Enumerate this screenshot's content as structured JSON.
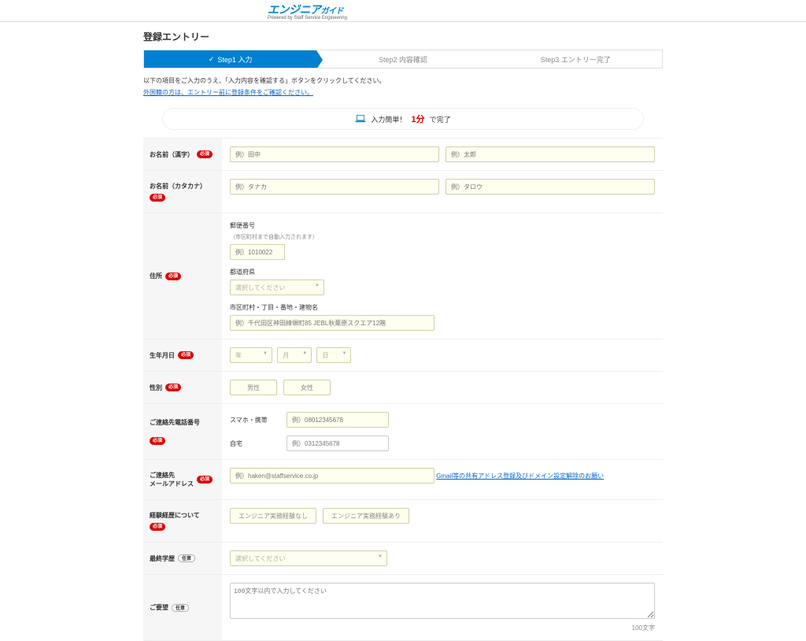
{
  "logo": {
    "main": "エンジニア",
    "sub": "ガイド",
    "tag": "Powered by Staff Service Engineering"
  },
  "page_title": "登録エントリー",
  "steps": {
    "s1": "Step1 入力",
    "s2": "Step2 内容確認",
    "s3": "Step3 エントリー完了",
    "check": "✓"
  },
  "intro": {
    "text": "以下の項目をご入力のうえ、「入力内容を確認する」ボタンをクリックしてください。",
    "link": "外国籍の方は、エントリー前に登録条件をご確認ください。"
  },
  "banner": {
    "t1": "入力簡単！",
    "highlight": "1分",
    "t2": "で完了"
  },
  "labels": {
    "name_kanji": "お名前（漢字）",
    "name_kana": "お名前（カタカナ）",
    "address": "住所",
    "birth": "生年月日",
    "gender": "性別",
    "phone": "ご連絡先電話番号",
    "email_l1": "ご連絡先",
    "email_l2": "メールアドレス",
    "exp": "経験経歴について",
    "edu": "最終学歴",
    "wish": "ご要望",
    "req": "必須",
    "opt": "任意"
  },
  "placeholders": {
    "surname_kanji": "例）田中",
    "given_kanji": "例）太郎",
    "surname_kana": "例）タナカ",
    "given_kana": "例）タロウ",
    "zip": "例）1010022",
    "pref": "選択してください",
    "addr": "例）千代田区神田練塀町85 JEBL秋葉原スクエア12階",
    "year": "年",
    "month": "月",
    "day": "日",
    "mobile": "例）08012345678",
    "landline": "例）0312345678",
    "email": "例）haken@staffservice.co.jp",
    "edu_sel": "選択してください",
    "wish": "100文字以内で入力してください"
  },
  "sub_labels": {
    "zip_lbl": "郵便番号",
    "zip_note": "（市区町村まで自動入力されます）",
    "pref": "都道府県",
    "addr": "市区町村・丁目・番地・建物名",
    "mobile": "スマホ・携帯",
    "landline": "自宅",
    "email_link": "Gmail等の共有アドレス登録及びドメイン設定解除のお願い",
    "char_limit": "100文字"
  },
  "options": {
    "male": "男性",
    "female": "女性",
    "exp_no": "エンジニア実務経験なし",
    "exp_yes": "エンジニア実務経験あり"
  }
}
